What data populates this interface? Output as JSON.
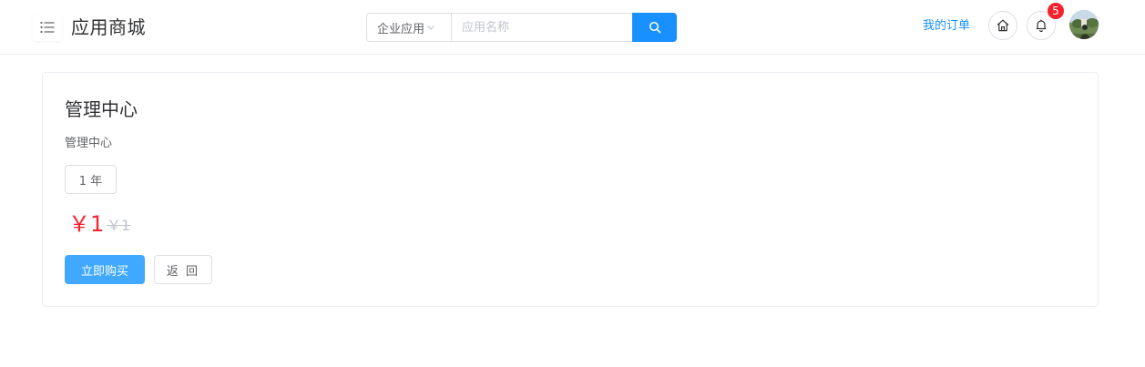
{
  "header": {
    "app_title": "应用商城",
    "menu_icon": "list-icon",
    "search": {
      "category": "企业应用",
      "placeholder": "应用名称",
      "button_icon": "search-icon"
    },
    "orders_link": "我的订单",
    "home_icon": "home-icon",
    "bell_icon": "bell-icon",
    "notification_count": "5",
    "avatar": "avatar"
  },
  "product": {
    "title": "管理中心",
    "description": "管理中心",
    "plan_option": "1 年",
    "price": "￥1",
    "original_price": "￥1",
    "buy_label": "立即购买",
    "back_label": "返 回"
  },
  "colors": {
    "primary": "#1890ff",
    "buy_button": "#40a9ff",
    "price": "#f5222d",
    "badge": "#f5222d"
  }
}
